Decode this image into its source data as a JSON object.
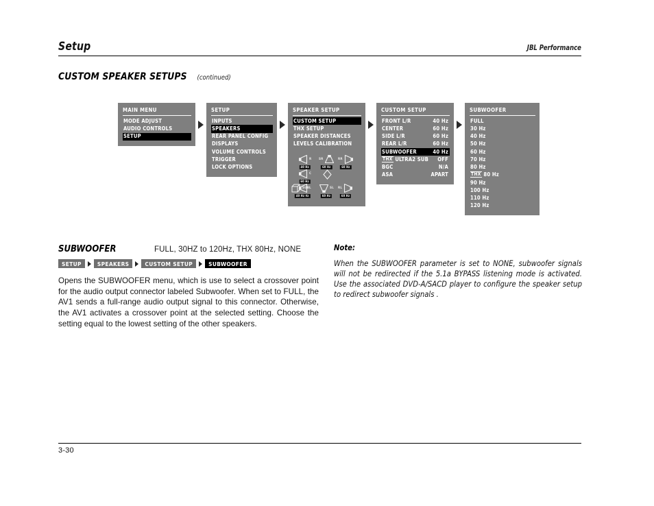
{
  "header": {
    "title": "Setup",
    "brand": "JBL Performance"
  },
  "section": {
    "title": "CUSTOM SPEAKER SETUPS",
    "suffix": "(continued)"
  },
  "osd_flow": {
    "arrow_icon": "triangle-right-icon",
    "panels": [
      {
        "id": "main-menu",
        "title": "MAIN MENU",
        "rows": [
          {
            "label": "MODE ADJUST",
            "selected": false
          },
          {
            "label": "AUDIO CONTROLS",
            "selected": false
          },
          {
            "label": "SETUP",
            "selected": true
          }
        ]
      },
      {
        "id": "setup",
        "title": "SETUP",
        "rows": [
          {
            "label": "INPUTS",
            "selected": false
          },
          {
            "label": "SPEAKERS",
            "selected": true
          },
          {
            "label": "REAR PANEL CONFIG",
            "selected": false
          },
          {
            "label": "DISPLAYS",
            "selected": false
          },
          {
            "label": "VOLUME CONTROLS",
            "selected": false
          },
          {
            "label": "TRIGGER",
            "selected": false
          },
          {
            "label": "LOCK OPTIONS",
            "selected": false
          }
        ]
      },
      {
        "id": "speaker-setup",
        "title": "SPEAKER SETUP",
        "rows": [
          {
            "label": "CUSTOM SETUP",
            "selected": true
          },
          {
            "label": "THX SETUP",
            "selected": false
          },
          {
            "label": "SPEAKER DISTANCES",
            "selected": false
          },
          {
            "label": "LEVELS CALIBRATION",
            "selected": false
          }
        ],
        "speaker_map": [
          {
            "name": "front-left-speaker",
            "label": "L",
            "value": "40 Hz"
          },
          {
            "name": "front-right-speaker",
            "label": "R",
            "value": "40 Hz"
          },
          {
            "name": "center-speaker",
            "label": "C",
            "value": "60 Hz"
          },
          {
            "name": "side-left-speaker",
            "label": "SL",
            "value": "60 Hz"
          },
          {
            "name": "side-right-speaker",
            "label": "SR",
            "value": "60 Hz"
          },
          {
            "name": "rear-left-speaker",
            "label": "RL",
            "value": "60 Hz"
          },
          {
            "name": "rear-right-speaker",
            "label": "RR",
            "value": "60 Hz"
          },
          {
            "name": "subwoofer-speaker",
            "label": "SUB",
            "value": "40 Hz"
          }
        ]
      },
      {
        "id": "custom-setup",
        "title": "CUSTOM SETUP",
        "entries": [
          {
            "key": "FRONT L/R",
            "value": "40 Hz",
            "selected": false,
            "thx": false
          },
          {
            "key": "CENTER",
            "value": "60 Hz",
            "selected": false,
            "thx": false
          },
          {
            "key": "SIDE L/R",
            "value": "60 Hz",
            "selected": false,
            "thx": false
          },
          {
            "key": "REAR L/R",
            "value": "60 Hz",
            "selected": false,
            "thx": false
          },
          {
            "key": "SUBWOOFER",
            "value": "40 Hz",
            "selected": true,
            "thx": false
          },
          {
            "key": "ULTRA2 SUB",
            "value": "OFF",
            "selected": false,
            "thx": true
          },
          {
            "key": "BGC",
            "value": "N/A",
            "selected": false,
            "thx": false
          },
          {
            "key": "ASA",
            "value": "APART",
            "selected": false,
            "thx": false
          }
        ]
      },
      {
        "id": "subwoofer",
        "title": "SUBWOOFER",
        "rows": [
          {
            "label": "FULL",
            "selected": false,
            "thx": false
          },
          {
            "label": "30 Hz",
            "selected": false,
            "thx": false
          },
          {
            "label": "40 Hz",
            "selected": false,
            "thx": false
          },
          {
            "label": "50 Hz",
            "selected": false,
            "thx": false
          },
          {
            "label": "60 Hz",
            "selected": false,
            "thx": false
          },
          {
            "label": "70 Hz",
            "selected": false,
            "thx": false
          },
          {
            "label": "80 Hz",
            "selected": false,
            "thx": false
          },
          {
            "label": "80 Hz",
            "selected": false,
            "thx": true
          },
          {
            "label": "90 Hz",
            "selected": false,
            "thx": false
          },
          {
            "label": "100 Hz",
            "selected": false,
            "thx": false
          },
          {
            "label": "110 Hz",
            "selected": false,
            "thx": false
          },
          {
            "label": "120 Hz",
            "selected": false,
            "thx": false
          }
        ]
      }
    ]
  },
  "parameter": {
    "name": "SUBWOOFER",
    "values": "FULL, 30HZ to 120Hz, THX 80Hz, NONE",
    "breadcrumbs": [
      {
        "label": "SETUP",
        "active": false
      },
      {
        "label": "SPEAKERS",
        "active": false
      },
      {
        "label": "CUSTOM SETUP",
        "active": false
      },
      {
        "label": "SUBWOOFER",
        "active": true
      }
    ],
    "description": "Opens the SUBWOOFER menu, which is use to select a crossover point for the audio output connector labeled Subwoofer. When set to FULL, the AV1 sends a full-range audio output signal to this connector. Otherwise, the AV1 activates a crossover point at the selected setting. Choose the setting equal to the lowest setting of the other speakers."
  },
  "note": {
    "heading": "Note:",
    "body": "When the SUBWOOFER parameter is set to NONE, subwoofer signals will not be redirected if the 5.1a BYPASS listening mode is activated. Use the associated DVD-A/SACD player to configure the speaker setup to redirect subwoofer signals ."
  },
  "footer": {
    "page_number": "3-30"
  },
  "colors": {
    "panel_bg": "#7f7f7f",
    "panel_selected_bg": "#000000",
    "panel_text": "#ffffff",
    "crumb_bg": "#6f6f6f",
    "crumb_active_bg": "#000000",
    "rule": "#000000"
  }
}
